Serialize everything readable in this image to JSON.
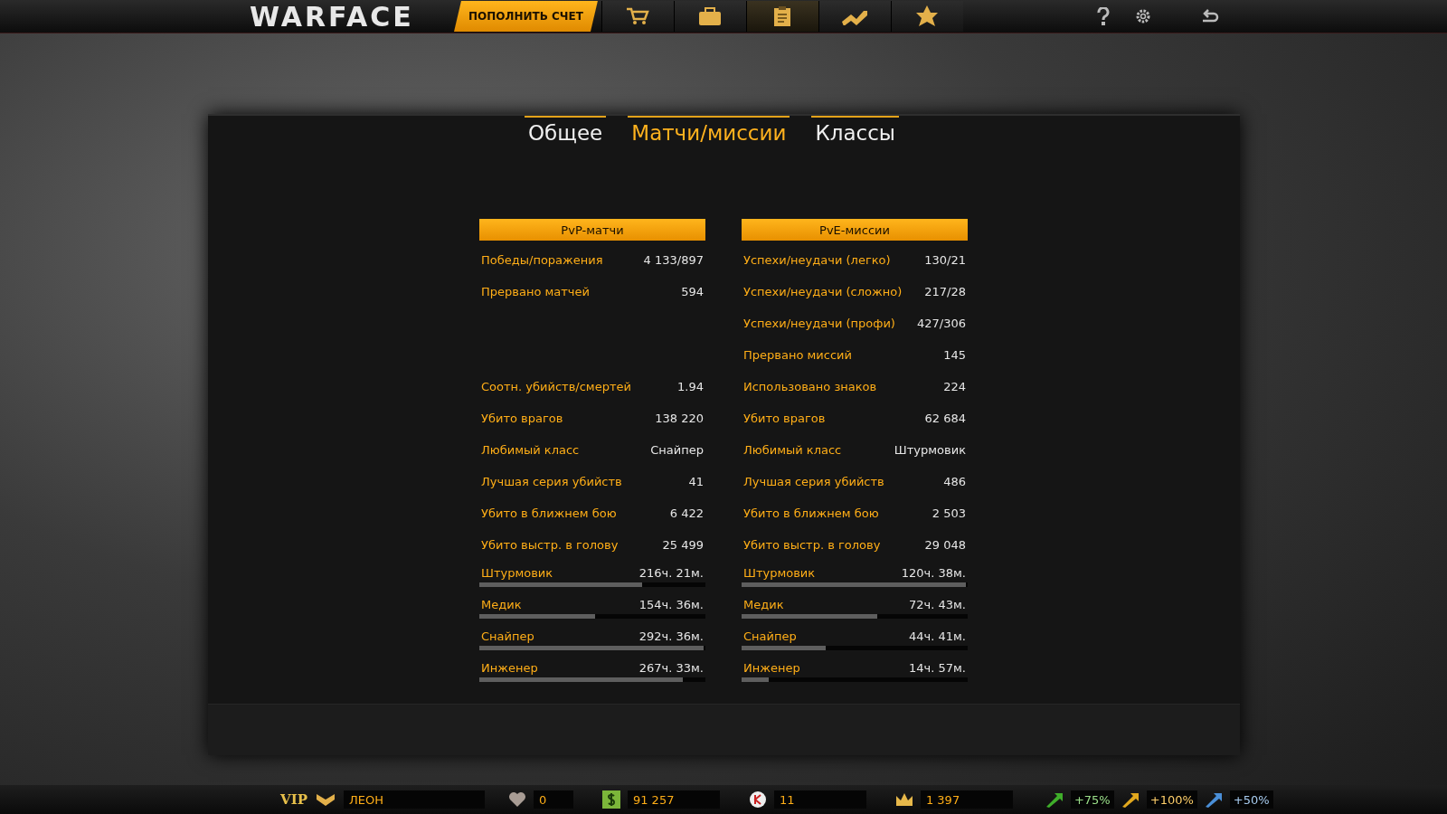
{
  "top_bar": {
    "logo": "WARFACE",
    "topup_button": "ПОПОЛНИТЬ СЧЕТ",
    "nav": [
      {
        "selected": false
      },
      {
        "selected": false
      },
      {
        "selected": true
      },
      {
        "selected": false
      },
      {
        "selected": false
      }
    ]
  },
  "tabs": [
    {
      "label": "Общее",
      "selected": false
    },
    {
      "label": "Матчи/миссии",
      "selected": true
    },
    {
      "label": "Классы",
      "selected": false
    }
  ],
  "tables": [
    {
      "title": "PvP-матчи",
      "match_rows": [
        {
          "label": "Победы/поражения",
          "value": "4 133/897"
        },
        {
          "label": "Прервано матчей",
          "value": "594"
        }
      ],
      "combat_rows": [
        {
          "label": "Соотн. убийств/смертей",
          "value": "1.94"
        },
        {
          "label": "Убито врагов",
          "value": "138 220"
        },
        {
          "label": "Любимый класс",
          "value": "Снайпер"
        },
        {
          "label": "Лучшая серия убийств",
          "value": "41"
        },
        {
          "label": "Убито в ближнем бою",
          "value": "6 422"
        },
        {
          "label": "Убито выстр. в голову",
          "value": "25 499"
        }
      ],
      "classes": [
        {
          "name": "Штурмовик",
          "time": "216ч. 21м.",
          "level": 0.72
        },
        {
          "name": "Медик",
          "time": "154ч. 36м.",
          "level": 0.51
        },
        {
          "name": "Снайпер",
          "time": "292ч. 36м.",
          "level": 0.99
        },
        {
          "name": "Инженер",
          "time": "267ч. 33м.",
          "level": 0.9
        }
      ]
    },
    {
      "title": "PvE-миссии",
      "match_rows": [
        {
          "label": "Успехи/неудачи (легко)",
          "value": "130/21"
        },
        {
          "label": "Успехи/неудачи (сложно)",
          "value": "217/28"
        },
        {
          "label": "Успехи/неудачи (профи)",
          "value": "427/306"
        },
        {
          "label": "Прервано миссий",
          "value": "145"
        }
      ],
      "combat_rows": [
        {
          "label": "Использовано знаков",
          "value": "224"
        },
        {
          "label": "Убито врагов",
          "value": "62 684"
        },
        {
          "label": "Любимый класс",
          "value": "Штурмовик"
        },
        {
          "label": "Лучшая серия убийств",
          "value": "486"
        },
        {
          "label": "Убито в ближнем бою",
          "value": "2 503"
        },
        {
          "label": "Убито выстр. в голову",
          "value": "29 048"
        }
      ],
      "classes": [
        {
          "name": "Штурмовик",
          "time": "120ч. 38м.",
          "level": 0.99
        },
        {
          "name": "Медик",
          "time": "72ч. 43м.",
          "level": 0.6
        },
        {
          "name": "Снайпер",
          "time": "44ч. 41м.",
          "level": 0.37
        },
        {
          "name": "Инженер",
          "time": "14ч. 57м.",
          "level": 0.12
        }
      ]
    }
  ],
  "bottom_bar": {
    "vip": "VIP",
    "player": "ЛЕОН",
    "currencies": [
      {
        "value": "0"
      },
      {
        "value": "91 257"
      },
      {
        "value": "11"
      },
      {
        "value": "1 397"
      }
    ],
    "boosters": [
      {
        "value": "+75%",
        "color": "#3fae2a"
      },
      {
        "value": "+100%",
        "color": "#e2a81e"
      },
      {
        "value": "+50%",
        "color": "#4a8fd8"
      }
    ]
  }
}
